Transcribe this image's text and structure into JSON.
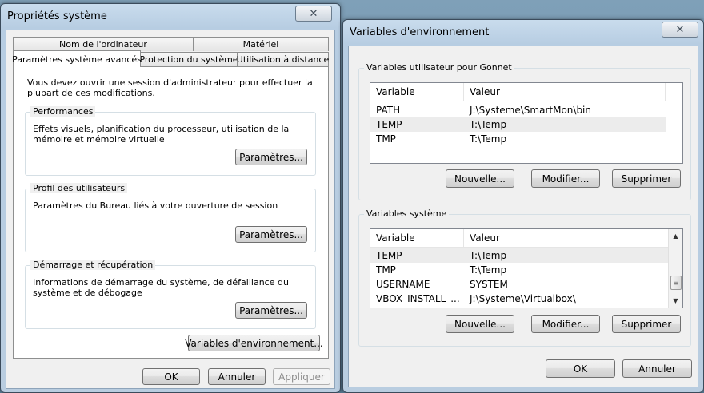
{
  "sysprops": {
    "title": "Propriétés système",
    "close_glyph": "✕",
    "tabs_row1": [
      "Nom de l'ordinateur",
      "Matériel"
    ],
    "tabs_row2": [
      "Paramètres système avancés",
      "Protection du système",
      "Utilisation à distance"
    ],
    "admin_notice": "Vous devez ouvrir une session d'administrateur pour effectuer la plupart de ces modifications.",
    "performance": {
      "label": "Performances",
      "text": "Effets visuels, planification du processeur, utilisation de la mémoire et mémoire virtuelle",
      "button": "Paramètres..."
    },
    "profiles": {
      "label": "Profil des utilisateurs",
      "text": "Paramètres du Bureau liés à votre ouverture de session",
      "button": "Paramètres..."
    },
    "startup": {
      "label": "Démarrage et récupération",
      "text": "Informations de démarrage du système, de défaillance du système et de débogage",
      "button": "Paramètres..."
    },
    "env_button": "Variables d'environnement...",
    "ok": "OK",
    "cancel": "Annuler",
    "apply": "Appliquer"
  },
  "envvars": {
    "title": "Variables d'environnement",
    "close_glyph": "✕",
    "user_group": {
      "label": "Variables utilisateur pour Gonnet",
      "columns": [
        "Variable",
        "Valeur"
      ],
      "rows": [
        [
          "PATH",
          "J:\\Systeme\\SmartMon\\bin"
        ],
        [
          "TEMP",
          "T:\\Temp"
        ],
        [
          "TMP",
          "T:\\Temp"
        ]
      ],
      "new": "Nouvelle...",
      "edit": "Modifier...",
      "delete": "Supprimer"
    },
    "system_group": {
      "label": "Variables système",
      "columns": [
        "Variable",
        "Valeur"
      ],
      "rows": [
        [
          "TEMP",
          "T:\\Temp"
        ],
        [
          "TMP",
          "T:\\Temp"
        ],
        [
          "USERNAME",
          "SYSTEM"
        ],
        [
          "VBOX_INSTALL_...",
          "J:\\Systeme\\Virtualbox\\"
        ]
      ],
      "new": "Nouvelle...",
      "edit": "Modifier...",
      "delete": "Supprimer"
    },
    "ok": "OK",
    "cancel": "Annuler"
  }
}
